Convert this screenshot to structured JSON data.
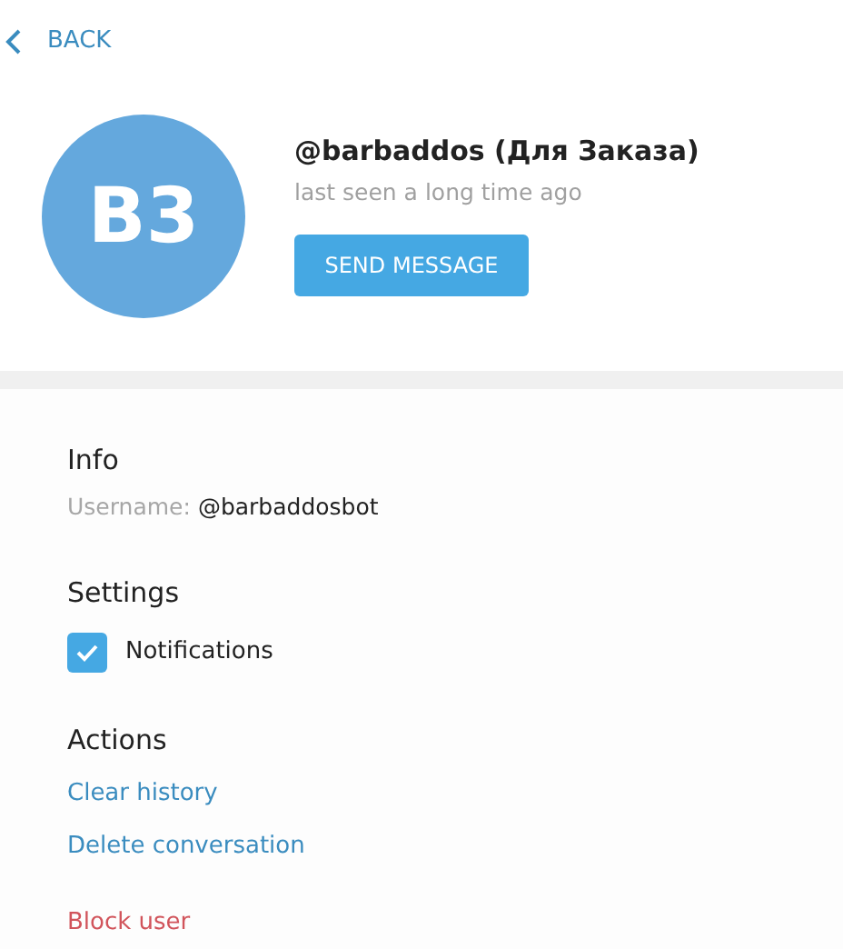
{
  "back": {
    "label": "BACK"
  },
  "profile": {
    "initials": "B3",
    "name": "@barbaddos (Для Заказа)",
    "status": "last seen a long time ago",
    "button": "SEND MESSAGE"
  },
  "info": {
    "title": "Info",
    "username_label": "Username:",
    "username": "@barbaddosbot"
  },
  "settings": {
    "title": "Settings",
    "options": [
      {
        "label": "Notifications",
        "checked": true
      }
    ]
  },
  "actions": {
    "title": "Actions",
    "items": [
      {
        "label": "Clear history",
        "kind": "link"
      },
      {
        "label": "Delete conversation",
        "kind": "link"
      },
      {
        "label": "Block user",
        "kind": "danger"
      }
    ]
  }
}
